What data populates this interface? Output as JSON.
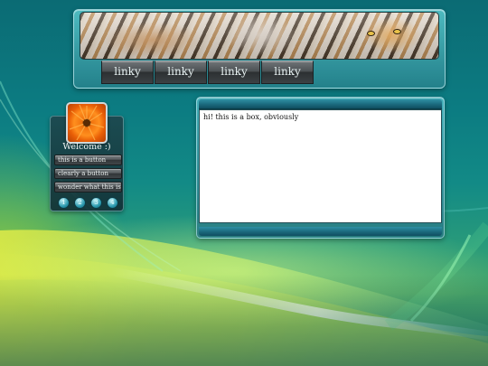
{
  "header": {
    "nav": [
      "linky",
      "linky",
      "linky",
      "linky"
    ]
  },
  "sidebar": {
    "welcome": "Welcome :)",
    "buttons": [
      "this is a button",
      "clearly a button",
      "wonder what this is"
    ],
    "pages": [
      "1",
      "2",
      "3",
      "4"
    ]
  },
  "content": {
    "text": "hi! this is a box, obviously"
  },
  "colors": {
    "accent": "#1c6c80",
    "button_dark": "#313537",
    "avatar_flower": "#f0720e"
  },
  "icons": {
    "banner": "tiger-photo",
    "avatar": "orange-flower-avatar"
  }
}
